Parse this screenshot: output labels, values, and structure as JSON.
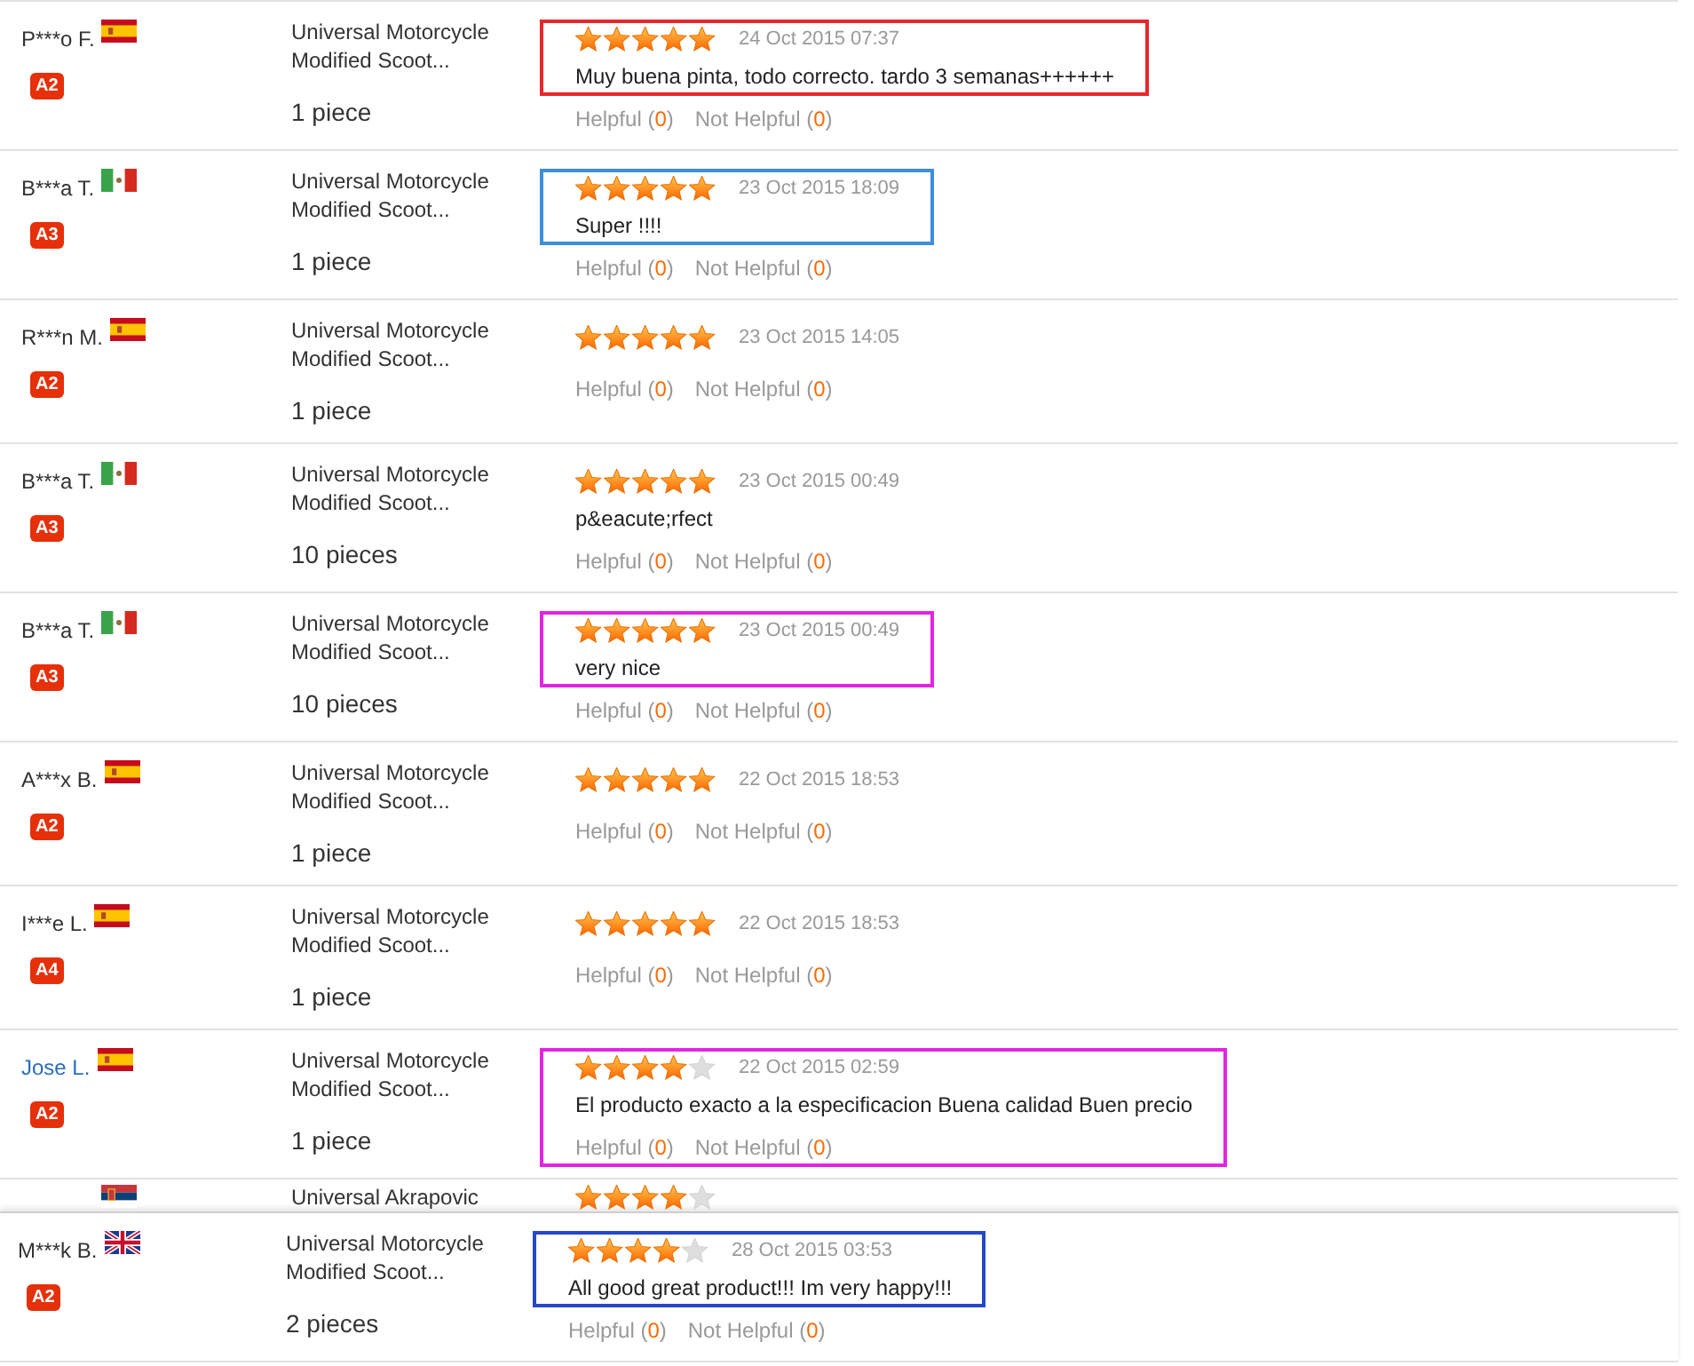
{
  "reviews": [
    {
      "reviewer": "P***o F.",
      "linked": false,
      "flag": {
        "kind": "spain"
      },
      "badge": "A2",
      "product": "Universal Motorcycle Modified Scoot...",
      "quantity": "1 piece",
      "stars": 5,
      "date": "24 Oct 2015 07:37",
      "text": "Muy buena pinta, todo correcto. tardo 3 semanas++++++",
      "helpful": {
        "label": "Helpful",
        "count": "(0)"
      },
      "not_helpful": {
        "label": "Not Helpful",
        "count": "(0)"
      },
      "highlight": {
        "color": "#e8262d",
        "includes_votes": false
      }
    },
    {
      "reviewer": "B***a T.",
      "linked": false,
      "flag": {
        "kind": "mexico"
      },
      "badge": "A3",
      "product": "Universal Motorcycle Modified Scoot...",
      "quantity": "1 piece",
      "stars": 5,
      "date": "23 Oct 2015 18:09",
      "text": "Super !!!!",
      "helpful": {
        "label": "Helpful",
        "count": "(0)"
      },
      "not_helpful": {
        "label": "Not Helpful",
        "count": "(0)"
      },
      "highlight": {
        "color": "#3d8fdb",
        "includes_votes": false
      }
    },
    {
      "reviewer": "R***n M.",
      "linked": false,
      "flag": {
        "kind": "spain"
      },
      "badge": "A2",
      "product": "Universal Motorcycle Modified Scoot...",
      "quantity": "1 piece",
      "stars": 5,
      "date": "23 Oct 2015 14:05",
      "helpful": {
        "label": "Helpful",
        "count": "(0)"
      },
      "not_helpful": {
        "label": "Not Helpful",
        "count": "(0)"
      }
    },
    {
      "reviewer": "B***a T.",
      "linked": false,
      "flag": {
        "kind": "mexico"
      },
      "badge": "A3",
      "product": "Universal Motorcycle Modified Scoot...",
      "quantity": "10 pieces",
      "stars": 5,
      "date": "23 Oct 2015 00:49",
      "text": "p&eacute;rfect",
      "helpful": {
        "label": "Helpful",
        "count": "(0)"
      },
      "not_helpful": {
        "label": "Not Helpful",
        "count": "(0)"
      }
    },
    {
      "reviewer": "B***a T.",
      "linked": false,
      "flag": {
        "kind": "mexico"
      },
      "badge": "A3",
      "product": "Universal Motorcycle Modified Scoot...",
      "quantity": "10 pieces",
      "stars": 5,
      "date": "23 Oct 2015 00:49",
      "text": "very nice",
      "helpful": {
        "label": "Helpful",
        "count": "(0)"
      },
      "not_helpful": {
        "label": "Not Helpful",
        "count": "(0)"
      },
      "highlight": {
        "color": "#e324e3",
        "includes_votes": false
      }
    },
    {
      "reviewer": "A***x B.",
      "linked": false,
      "flag": {
        "kind": "spain"
      },
      "badge": "A2",
      "product": "Universal Motorcycle Modified Scoot...",
      "quantity": "1 piece",
      "stars": 5,
      "date": "22 Oct 2015 18:53",
      "helpful": {
        "label": "Helpful",
        "count": "(0)"
      },
      "not_helpful": {
        "label": "Not Helpful",
        "count": "(0)"
      }
    },
    {
      "reviewer": "I***e L.",
      "linked": false,
      "flag": {
        "kind": "spain"
      },
      "badge": "A4",
      "product": "Universal Motorcycle Modified Scoot...",
      "quantity": "1 piece",
      "stars": 5,
      "date": "22 Oct 2015 18:53",
      "helpful": {
        "label": "Helpful",
        "count": "(0)"
      },
      "not_helpful": {
        "label": "Not Helpful",
        "count": "(0)"
      }
    },
    {
      "reviewer": "Jose L.",
      "linked": true,
      "flag": {
        "kind": "spain"
      },
      "badge": "A2",
      "product": "Universal Motorcycle Modified Scoot...",
      "quantity": "1 piece",
      "stars": 4,
      "date": "22 Oct 2015 02:59",
      "text": "El producto exacto a la especificacion Buena calidad Buen precio",
      "helpful": {
        "label": "Helpful",
        "count": "(0)"
      },
      "not_helpful": {
        "label": "Not Helpful",
        "count": "(0)"
      },
      "highlight": {
        "color": "#e324e3",
        "includes_votes": true
      }
    }
  ],
  "cut_off_review": {
    "flag": {
      "kind": "serbia"
    },
    "product": "Universal Akrapovic",
    "stars": 4
  },
  "pasted_review": {
    "reviewer": "M***k B.",
    "linked": false,
    "flag": {
      "kind": "uk"
    },
    "badge": "A2",
    "product": "Universal Motorcycle Modified Scoot...",
    "quantity": "2 pieces",
    "stars": 4,
    "date": "28 Oct 2015 03:53",
    "text": "All good great product!!! Im very happy!!!",
    "helpful": {
      "label": "Helpful",
      "count": "(0)"
    },
    "not_helpful": {
      "label": "Not Helpful",
      "count": "(0)"
    },
    "highlight": {
      "color": "#2448c8",
      "includes_votes": false
    }
  }
}
